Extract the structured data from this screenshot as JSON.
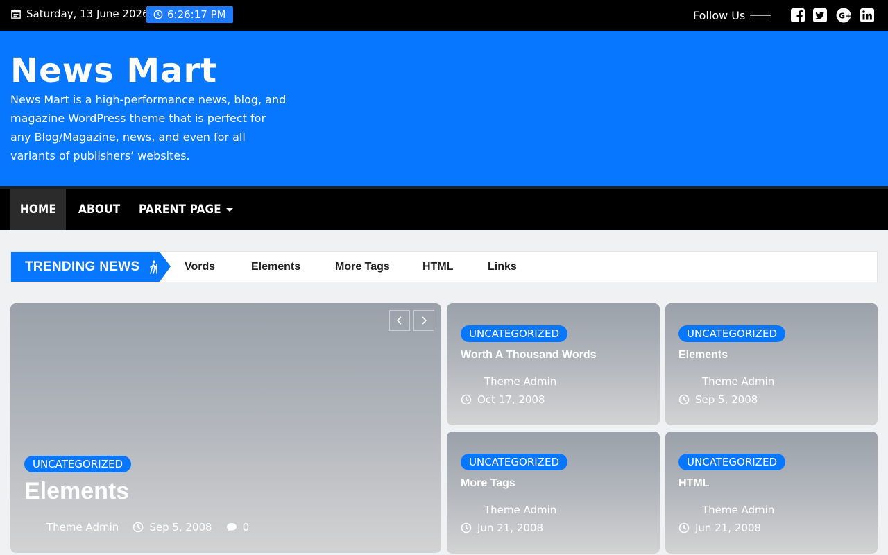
{
  "topbar": {
    "date": "Saturday, 13 June 2026",
    "time": "6:26:17 PM",
    "follow_label": "Follow Us",
    "social": [
      "facebook-icon",
      "twitter-icon",
      "google-plus-icon",
      "linkedin-icon"
    ]
  },
  "header": {
    "site_title": "News Mart",
    "description": "News Mart is a high-performance news, blog, and magazine WordPress theme that is perfect for any Blog/Magazine, news, and even for all variants of publishers’ websites."
  },
  "nav": {
    "items": [
      {
        "label": "Home",
        "active": true
      },
      {
        "label": "About",
        "active": false
      },
      {
        "label": "Parent Page",
        "active": false,
        "has_dropdown": true
      }
    ]
  },
  "trending": {
    "label": "TRENDING NEWS",
    "items": [
      "Vords",
      "Elements",
      "More Tags",
      "HTML",
      "Links"
    ]
  },
  "featured": {
    "category": "UNCATEGORIZED",
    "title": "Elements",
    "author": "Theme Admin",
    "date": "Sep 5, 2008",
    "comments": "0"
  },
  "grid": [
    {
      "category": "UNCATEGORIZED",
      "title": "Worth A Thousand Words",
      "author": "Theme Admin",
      "date": "Oct 17, 2008"
    },
    {
      "category": "UNCATEGORIZED",
      "title": "Elements",
      "author": "Theme Admin",
      "date": "Sep 5, 2008"
    },
    {
      "category": "UNCATEGORIZED",
      "title": "More Tags",
      "author": "Theme Admin",
      "date": "Jun 21, 2008"
    },
    {
      "category": "UNCATEGORIZED",
      "title": "HTML",
      "author": "Theme Admin",
      "date": "Jun 21, 2008"
    }
  ],
  "colors": {
    "accent": "#0877ff",
    "topbar_bg": "#000000",
    "nav_active_bg": "#2b2b2b",
    "page_bg": "#f0f1f3"
  }
}
